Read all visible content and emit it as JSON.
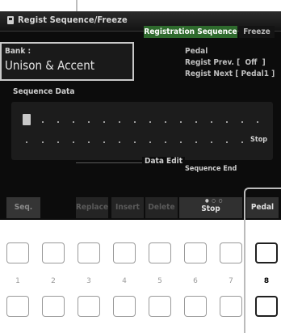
{
  "window": {
    "title": "Regist Sequence/Freeze",
    "title_icon": "memory-icon"
  },
  "tabs": [
    {
      "label": "Registration Sequence",
      "active": true
    },
    {
      "label": "Freeze",
      "active": false
    }
  ],
  "bank": {
    "label": "Bank :",
    "name": "Unison & Accent"
  },
  "pedal": {
    "label": "Pedal",
    "regist_prev": "Regist Prev. [  Off  ]",
    "regist_next": "Regist Next [ Pedal1 ]"
  },
  "sequence": {
    "label": "Sequence Data",
    "stop_marker": "Stop"
  },
  "data_edit": {
    "label": "Data Edit",
    "sequence_end_label": "Sequence End"
  },
  "buttons": {
    "seq": "Seq.",
    "replace": "Replace",
    "insert": "Insert",
    "delete": "Delete",
    "stop": "Stop",
    "stop_indicator": "● ○ ○",
    "pedal": "Pedal"
  },
  "panel_buttons": {
    "numbers": [
      "1",
      "2",
      "3",
      "4",
      "5",
      "6",
      "7",
      "8"
    ],
    "selected_number": "8"
  },
  "colors": {
    "active_tab": "#2e6a2d",
    "screen_bg": "#0c0c0c"
  }
}
